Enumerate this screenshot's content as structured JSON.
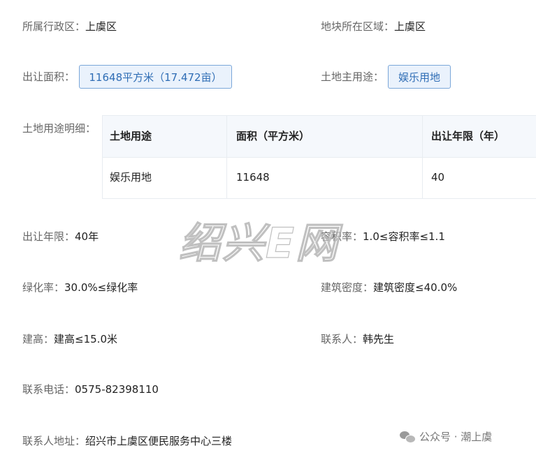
{
  "fields": {
    "district_label": "所属行政区：",
    "district_value": "上虞区",
    "area_label": "地块所在区域：",
    "area_value": "上虞区",
    "land_area_label": "出让面积：",
    "land_area_value": "11648平方米（17.472亩）",
    "main_use_label": "土地主用途：",
    "main_use_value": "娱乐用地",
    "use_detail_label": "土地用途明细：",
    "term_label": "出让年限：",
    "term_value": "40年",
    "far_label": "容积率：",
    "far_value": "1.0≤容积率≤1.1",
    "green_label": "绿化率：",
    "green_value": "30.0%≤绿化率",
    "density_label": "建筑密度：",
    "density_value": "建筑密度≤40.0%",
    "height_label": "建高：",
    "height_value": "建高≤15.0米",
    "contact_label": "联系人：",
    "contact_value": "韩先生",
    "phone_label": "联系电话：",
    "phone_value": "0575-82398110",
    "address_label": "联系人地址：",
    "address_value": "绍兴市上虞区便民服务中心三楼"
  },
  "table": {
    "headers": [
      "土地用途",
      "面积（平方米）",
      "出让年限（年）"
    ],
    "rows": [
      [
        "娱乐用地",
        "11648",
        "40"
      ]
    ]
  },
  "watermark": "绍兴E网",
  "footer": {
    "icon": "wechat-icon",
    "text": "公众号 · 潮上虞"
  }
}
